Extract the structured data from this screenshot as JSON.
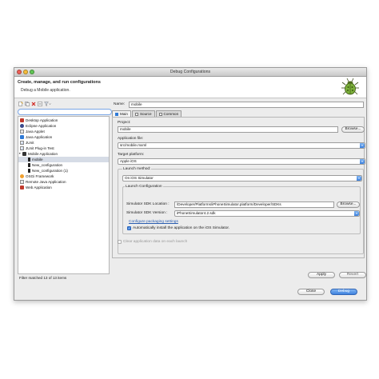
{
  "window": {
    "title": "Debug Configurations",
    "header_title": "Create, manage, and run configurations",
    "header_subtitle": "Debug a Mobile application."
  },
  "colors": {
    "accent": "#3d82de",
    "close_light": "#ee5f57",
    "min_light": "#f6bd3b",
    "zoom_light": "#62c655"
  },
  "left_toolbar": {
    "icons": [
      "new-configuration-icon",
      "duplicate-icon",
      "delete-icon",
      "collapse-all-icon",
      "filter-icon"
    ]
  },
  "filter": {
    "value": "",
    "placeholder": ""
  },
  "tree": {
    "items": [
      {
        "label": "Desktop Application",
        "icon": "desktop-app-icon",
        "depth": 0
      },
      {
        "label": "Eclipse Application",
        "icon": "eclipse-app-icon",
        "depth": 0
      },
      {
        "label": "Java Applet",
        "icon": "java-applet-icon",
        "depth": 0
      },
      {
        "label": "Java Application",
        "icon": "java-app-icon",
        "depth": 0
      },
      {
        "label": "JUnit",
        "icon": "junit-icon",
        "depth": 0
      },
      {
        "label": "JUnit Plug-in Test",
        "icon": "junit-plugin-icon",
        "depth": 0
      },
      {
        "label": "Mobile Application",
        "icon": "mobile-app-icon",
        "depth": 0,
        "expanded": true
      },
      {
        "label": "mobile",
        "icon": "mobile-config-icon",
        "depth": 1,
        "selected": true
      },
      {
        "label": "New_configuration",
        "icon": "mobile-config-icon",
        "depth": 1
      },
      {
        "label": "New_configuration (1)",
        "icon": "mobile-config-icon",
        "depth": 1
      },
      {
        "label": "OSGi Framework",
        "icon": "osgi-icon",
        "depth": 0
      },
      {
        "label": "Remote Java Application",
        "icon": "remote-java-icon",
        "depth": 0
      },
      {
        "label": "Web Application",
        "icon": "web-app-icon",
        "depth": 0
      }
    ]
  },
  "filter_status": "Filter matched 13 of 13 items",
  "config": {
    "name_label": "Name:",
    "name_value": "mobile",
    "tabs": [
      {
        "label": "Main",
        "icon": "main-tab-icon",
        "active": true
      },
      {
        "label": "Source",
        "icon": "source-tab-icon",
        "active": false
      },
      {
        "label": "Common",
        "icon": "common-tab-icon",
        "active": false
      }
    ],
    "project_label": "Project:",
    "project_value": "mobile",
    "browse_label": "Browse...",
    "app_file_label": "Application file:",
    "app_file_value": "src/mobile.mxml",
    "target_label": "Target platform:",
    "target_value": "Apple iOS",
    "launch_method_label": "Launch method:",
    "launch_method_value": "On iOS Simulator",
    "launch_config_label": "Launch Configuration",
    "sdk_location_label": "Simulator SDK Location :",
    "sdk_location_value": "/Developer/Platforms/iPhoneSimulator.platform/Developer/SDKs",
    "sdk_browse_label": "Browse...",
    "sdk_version_label": "Simulator SDK Version :",
    "sdk_version_value": "iPhoneSimulator4.2.sdk",
    "configure_link": "Configure packaging settings",
    "auto_install_label": "Automatically install the application on the iOS Simulator.",
    "auto_install_checked": true,
    "clear_data_label": "Clear application data on each launch",
    "clear_data_checked": false,
    "apply_label": "Apply",
    "revert_label": "Revert"
  },
  "footer": {
    "close_label": "Close",
    "debug_label": "Debug"
  }
}
